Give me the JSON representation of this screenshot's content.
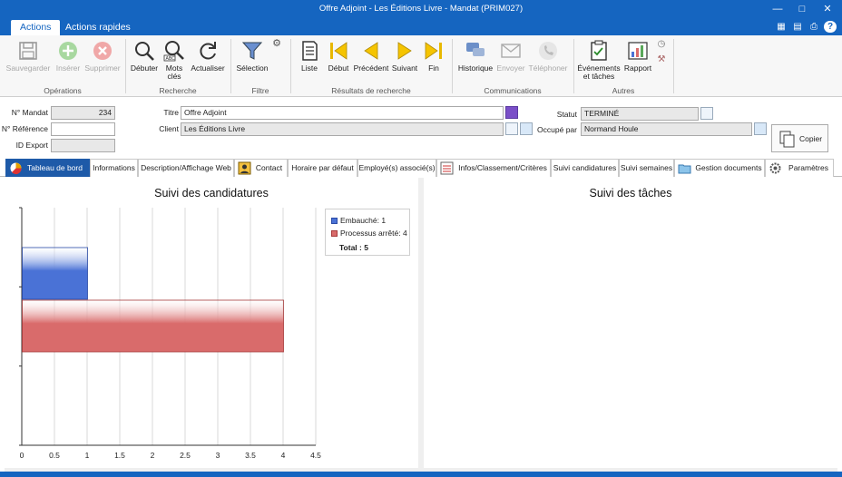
{
  "window": {
    "title": "Offre Adjoint - Les Éditions Livre - Mandat (PRIM027)",
    "controls": [
      "minimize-icon",
      "maximize-icon",
      "close-icon"
    ]
  },
  "ribbon_tabs": [
    "Actions",
    "Actions rapides"
  ],
  "quick_tools": [
    "calculator-icon",
    "window-icon",
    "print-icon",
    "help-icon"
  ],
  "ribbon": {
    "groups": [
      {
        "label": "Opérations",
        "buttons": [
          {
            "label": "Sauvegarder",
            "icon": "save-icon",
            "disabled": true
          },
          {
            "label": "Insérer",
            "icon": "plus-icon",
            "disabled": true
          },
          {
            "label": "Supprimer",
            "icon": "delete-icon",
            "disabled": true
          }
        ]
      },
      {
        "label": "Recherche",
        "buttons": [
          {
            "label": "Débuter",
            "icon": "search-icon"
          },
          {
            "label": "Mots clés",
            "icon": "keyword-search-icon"
          },
          {
            "label": "Actualiser",
            "icon": "refresh-icon"
          }
        ]
      },
      {
        "label": "Filtre",
        "buttons": [
          {
            "label": "Sélection",
            "icon": "filter-icon"
          }
        ]
      },
      {
        "label": "Résultats de recherche",
        "buttons": [
          {
            "label": "Liste",
            "icon": "list-icon"
          },
          {
            "label": "Début",
            "icon": "first-icon"
          },
          {
            "label": "Précédent",
            "icon": "previous-icon"
          },
          {
            "label": "Suivant",
            "icon": "next-icon"
          },
          {
            "label": "Fin",
            "icon": "last-icon"
          }
        ]
      },
      {
        "label": "Communications",
        "buttons": [
          {
            "label": "Historique",
            "icon": "history-icon"
          },
          {
            "label": "Envoyer",
            "icon": "email-icon",
            "disabled": true
          },
          {
            "label": "Téléphoner",
            "icon": "phone-icon",
            "disabled": true
          }
        ]
      },
      {
        "label": "Autres",
        "buttons": [
          {
            "label": "Événements et tâches",
            "icon": "tasks-icon"
          },
          {
            "label": "Rapport",
            "icon": "report-icon"
          }
        ]
      }
    ]
  },
  "form": {
    "mandat_label": "N° Mandat",
    "mandat_value": "234",
    "reference_label": "N° Référence",
    "reference_value": "",
    "export_label": "ID Export",
    "export_value": "",
    "titre_label": "Titre",
    "titre_value": "Offre Adjoint",
    "client_label": "Client",
    "client_value": "Les Éditions Livre",
    "statut_label": "Statut",
    "statut_value": "TERMINÉ",
    "occupe_label": "Occupé par",
    "occupe_value": "Normand Houle",
    "copy_label": "Copier"
  },
  "tabs": [
    {
      "label": "Tableau de bord",
      "icon": "dashboard-icon",
      "active": true
    },
    {
      "label": "Informations"
    },
    {
      "label": "Description/Affichage Web"
    },
    {
      "label": "Contact",
      "icon": "contact-icon"
    },
    {
      "label": "Horaire par défaut"
    },
    {
      "label": "Employé(s) associé(s)"
    },
    {
      "label": "Infos/Classement/Critères",
      "icon": "list-icon"
    },
    {
      "label": "Suivi candidatures"
    },
    {
      "label": "Suivi semaines"
    },
    {
      "label": "Gestion documents",
      "icon": "folder-icon"
    },
    {
      "label": "Paramètres",
      "icon": "gear-icon"
    }
  ],
  "dashboard": {
    "left_title": "Suivi des candidatures",
    "right_title": "Suivi des tâches",
    "legend": {
      "items": [
        "Embauché: 1",
        "Processus arrêté: 4"
      ],
      "total": "Total : 5"
    }
  },
  "chart_data": {
    "type": "bar",
    "orientation": "horizontal",
    "title": "Suivi des candidatures",
    "series": [
      {
        "name": "Embauché",
        "value": 1,
        "color": "#4a72d6"
      },
      {
        "name": "Processus arrêté",
        "value": 4,
        "color": "#d96b6b"
      }
    ],
    "xlim": [
      0,
      4.5
    ],
    "xticks": [
      "0",
      "0.5",
      "1",
      "1.5",
      "2",
      "2.5",
      "3",
      "3.5",
      "4",
      "4.5"
    ],
    "grid": true,
    "legend": "top-right"
  }
}
